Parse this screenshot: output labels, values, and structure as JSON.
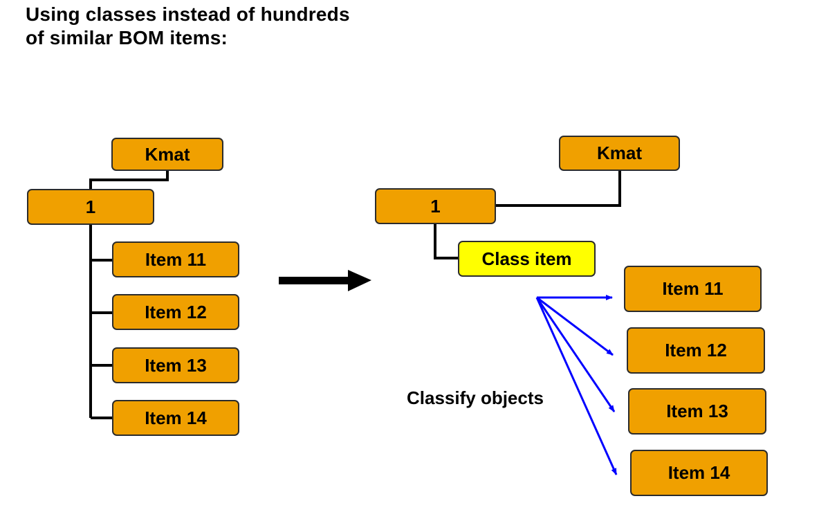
{
  "title_lines": [
    "Using classes instead of hundreds",
    "of similar BOM items:"
  ],
  "colors": {
    "box_fill": "#F0A000",
    "class_item_fill": "#FFFF00",
    "arrow_blue": "#0000FF",
    "line": "#000000"
  },
  "left_tree": {
    "root": "Kmat",
    "node": "1",
    "items": [
      "Item 11",
      "Item 12",
      "Item 13",
      "Item 14"
    ]
  },
  "transform_arrow": "right-arrow-icon",
  "right_tree": {
    "root": "Kmat",
    "node": "1",
    "class_item": "Class item",
    "annotation": "Classify objects",
    "items": [
      "Item 11",
      "Item 12",
      "Item 13",
      "Item 14"
    ]
  }
}
